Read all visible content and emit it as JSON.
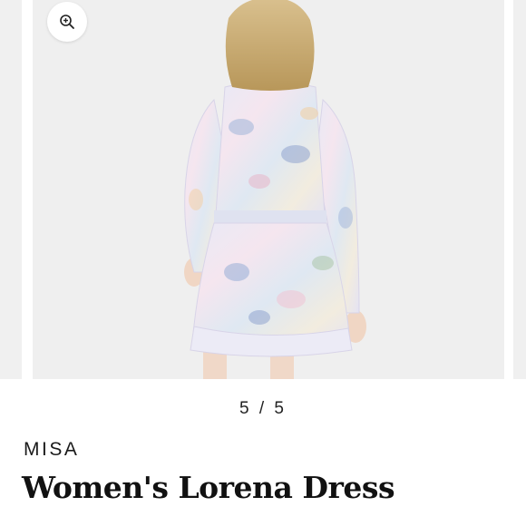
{
  "gallery": {
    "counter": "5 / 5",
    "zoom_icon": "zoom-in-icon",
    "photo_description_icon": "product-photo"
  },
  "product": {
    "brand": "MISA",
    "title": "Women's Lorena Dress"
  },
  "colors": {
    "photo_bg": "#efefef",
    "text": "#111111"
  }
}
